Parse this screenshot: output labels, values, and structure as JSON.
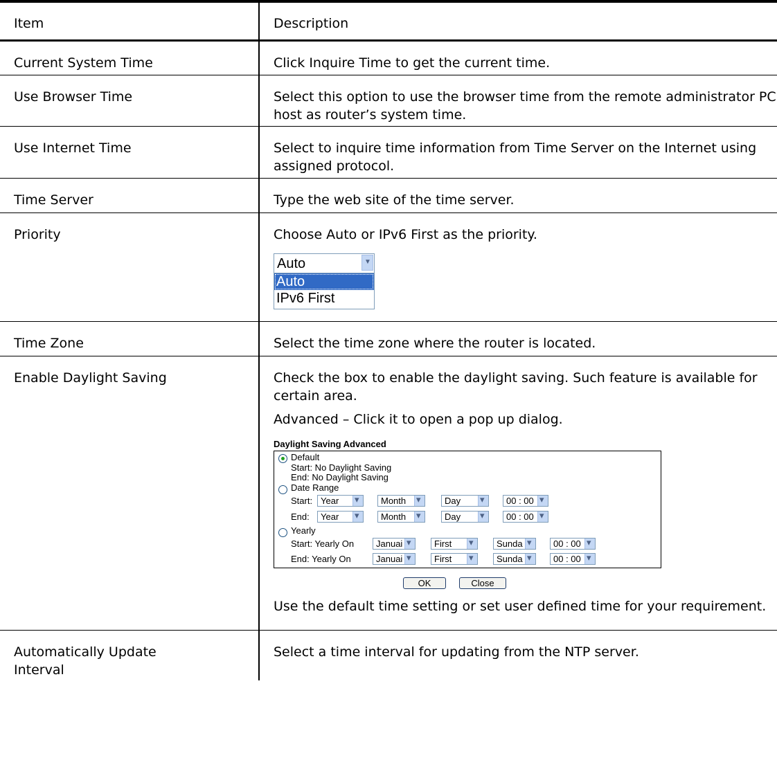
{
  "header": {
    "item": "Item",
    "description": "Description"
  },
  "rows": [
    {
      "item": "Current System Time",
      "desc": [
        "Click Inquire Time to get the current time."
      ]
    },
    {
      "item": "Use Browser Time",
      "desc": [
        "Select this option to use the browser time from the remote administrator PC host as router’s system time."
      ]
    },
    {
      "item": "Use Internet Time",
      "desc": [
        "Select to inquire time information from Time Server on the Internet using assigned protocol."
      ]
    },
    {
      "item": "Time Server",
      "desc": [
        "Type the web site of the time server."
      ]
    },
    {
      "item": "Priority",
      "desc": [
        "Choose Auto or IPv6 First as the priority."
      ]
    },
    {
      "item": "Time Zone",
      "desc": [
        "Select the time zone where the router is located."
      ]
    },
    {
      "item": "Enable Daylight Saving",
      "desc": [
        "Check the box to enable the daylight saving. Such feature is available for certain area.",
        "Advanced – Click it to open a pop up dialog.",
        "Use the default time setting or set user defined time for your requirement."
      ]
    },
    {
      "item": "Automatically Update Interval",
      "desc": [
        "Select a time interval for updating from the NTP server."
      ]
    }
  ],
  "priority_select": {
    "selected": "Auto",
    "options": [
      "Auto",
      "IPv6 First"
    ]
  },
  "dialog": {
    "title": "Daylight Saving Advanced",
    "default_label": "Default",
    "default_start": "Start: No Daylight Saving",
    "default_end": "End:   No Daylight Saving",
    "date_range_label": "Date Range",
    "start_label": "Start:",
    "end_label": "End:",
    "year": "Year",
    "month": "Month",
    "day": "Day",
    "time": "00 : 00",
    "yearly_label": "Yearly",
    "yearly_start": "Start: Yearly On",
    "yearly_end": "End:   Yearly On",
    "month_value": "Januai",
    "week_value": "First",
    "weekday_value": "Sunda",
    "ok": "OK",
    "close": "Close"
  }
}
